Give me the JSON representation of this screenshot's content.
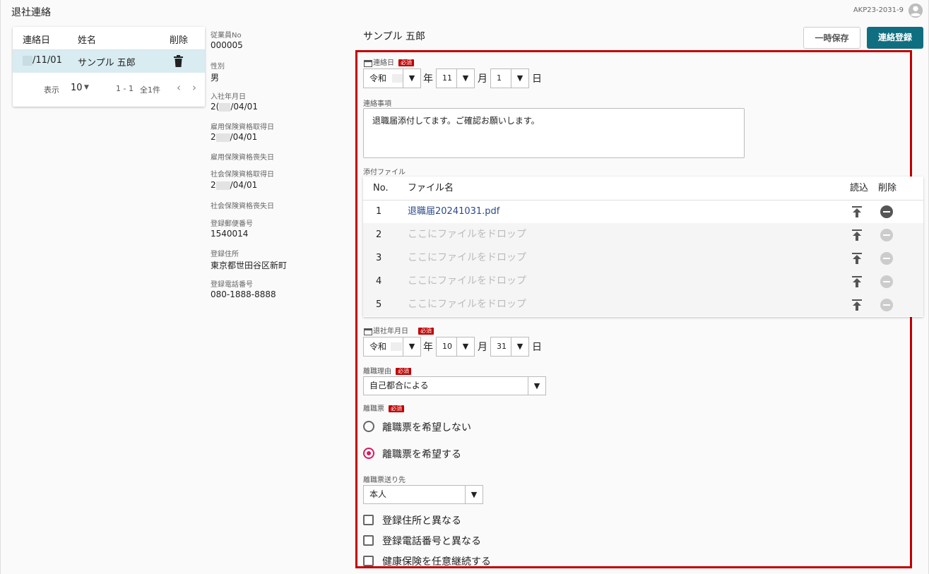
{
  "app": {
    "title": "退社連絡",
    "user_code": "AKP23-2031-9"
  },
  "list": {
    "headers": {
      "date": "連絡日",
      "name": "姓名",
      "delete": "削除"
    },
    "rows": [
      {
        "date": "/11/01",
        "name": "サンプル 五郎"
      }
    ],
    "footer": {
      "show_label": "表示",
      "per_page": "10",
      "range": "1 - 1",
      "total": "全1件"
    }
  },
  "employee": {
    "no_label": "従業員No",
    "no": "000005",
    "sex_label": "性別",
    "sex": "男",
    "hire_label": "入社年月日",
    "hire": "/04/01",
    "hire_prefix": "2(",
    "emp_ins_get_label": "雇用保険資格取得日",
    "emp_ins_get": "/04/01",
    "emp_ins_get_prefix": "2",
    "emp_ins_loss_label": "雇用保険資格喪失日",
    "soc_ins_get_label": "社会保険資格取得日",
    "soc_ins_get": "/04/01",
    "soc_ins_get_prefix": "2",
    "soc_ins_loss_label": "社会保険資格喪失日",
    "zip_label": "登録郵便番号",
    "zip": "1540014",
    "address_label": "登録住所",
    "address": "東京都世田谷区新町",
    "phone_label": "登録電話番号",
    "phone": "080-1888-8888"
  },
  "form": {
    "name": "サンプル 五郎",
    "save_temp": "一時保存",
    "register": "連絡登録",
    "required": "必須",
    "contact_date": {
      "label": "連絡日",
      "era": "令和",
      "month": "11",
      "day": "1",
      "unit_year": "年",
      "unit_month": "月",
      "unit_day": "日"
    },
    "notes": {
      "label": "連絡事項",
      "value": "退職届添付してます。ご確認お願いします。"
    },
    "attachments": {
      "label": "添付ファイル",
      "headers": {
        "no": "No.",
        "file": "ファイル名",
        "read": "読込",
        "delete": "削除"
      },
      "rows": [
        {
          "no": "1",
          "file": "退職届20241031.pdf",
          "has_file": true
        },
        {
          "no": "2",
          "file": "ここにファイルをドロップ",
          "has_file": false
        },
        {
          "no": "3",
          "file": "ここにファイルをドロップ",
          "has_file": false
        },
        {
          "no": "4",
          "file": "ここにファイルをドロップ",
          "has_file": false
        },
        {
          "no": "5",
          "file": "ここにファイルをドロップ",
          "has_file": false
        }
      ]
    },
    "leave_date": {
      "label": "退社年月日",
      "era": "令和",
      "month": "10",
      "day": "31"
    },
    "reason": {
      "label": "離職理由",
      "value": "自己都合による"
    },
    "separation_slip": {
      "label": "離職票",
      "options": [
        "離職票を希望しない",
        "離職票を希望する"
      ],
      "selected": 1
    },
    "slip_dest": {
      "label": "離職票送り先",
      "value": "本人"
    },
    "checks": [
      "登録住所と異なる",
      "登録電話番号と異なる",
      "健康保険を任意継続する"
    ]
  },
  "colors": {
    "accent": "#0f6f80",
    "required": "#c00000",
    "radio_on": "#d81b60",
    "row_selected": "#d8ecf1"
  }
}
